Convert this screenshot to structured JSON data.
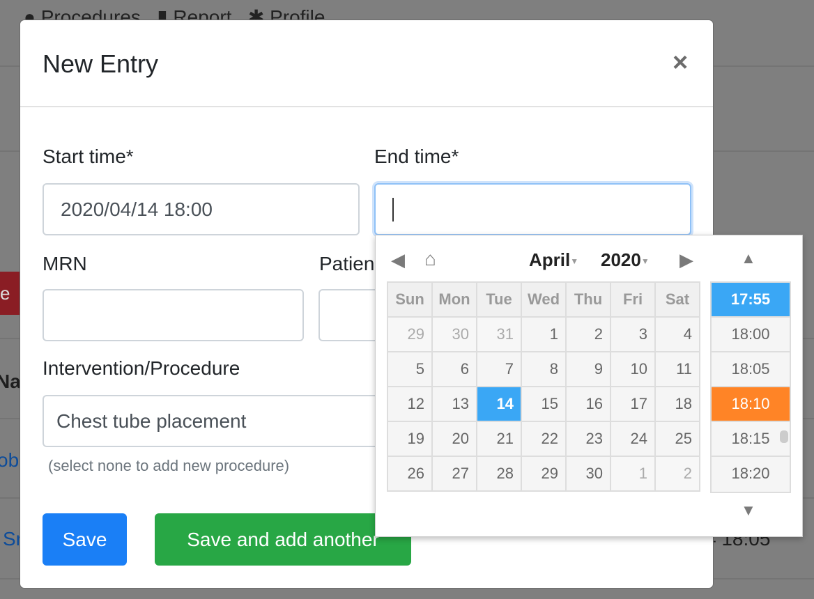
{
  "background": {
    "nav": [
      "Procedures",
      "Report",
      "Profile"
    ],
    "col_header": "Na",
    "links": [
      "ob",
      "Sr"
    ],
    "time_fragment": "4 18:05",
    "danger_fragment": "e"
  },
  "modal": {
    "title": "New Entry",
    "close": "×",
    "start_label": "Start time*",
    "start_value": "2020/04/14 18:00",
    "end_label": "End time*",
    "end_value": "",
    "mrn_label": "MRN",
    "mrn_value": "",
    "patient_label": "Patien",
    "patient_value": "",
    "procedure_label": "Intervention/Procedure",
    "procedure_value": "Chest tube placement",
    "procedure_help": "(select none to add new procedure)",
    "save": "Save",
    "save_another": "Save and add another"
  },
  "colors": {
    "primary": "#1a7ff6",
    "success": "#28a745",
    "selected": "#3aa7f5",
    "highlight": "#ff8426"
  },
  "picker": {
    "month": "April",
    "year": "2020",
    "weekdays": [
      "Sun",
      "Mon",
      "Tue",
      "Wed",
      "Thu",
      "Fri",
      "Sat"
    ],
    "weeks": [
      [
        "29",
        "30",
        "31",
        "1",
        "2",
        "3",
        "4"
      ],
      [
        "5",
        "6",
        "7",
        "8",
        "9",
        "10",
        "11"
      ],
      [
        "12",
        "13",
        "14",
        "15",
        "16",
        "17",
        "18"
      ],
      [
        "19",
        "20",
        "21",
        "22",
        "23",
        "24",
        "25"
      ],
      [
        "26",
        "27",
        "28",
        "29",
        "30",
        "1",
        "2"
      ]
    ],
    "selected_day": "14",
    "times": [
      "17:55",
      "18:00",
      "18:05",
      "18:10",
      "18:15",
      "18:20"
    ],
    "current_time": "17:55",
    "highlighted_time": "18:10"
  }
}
